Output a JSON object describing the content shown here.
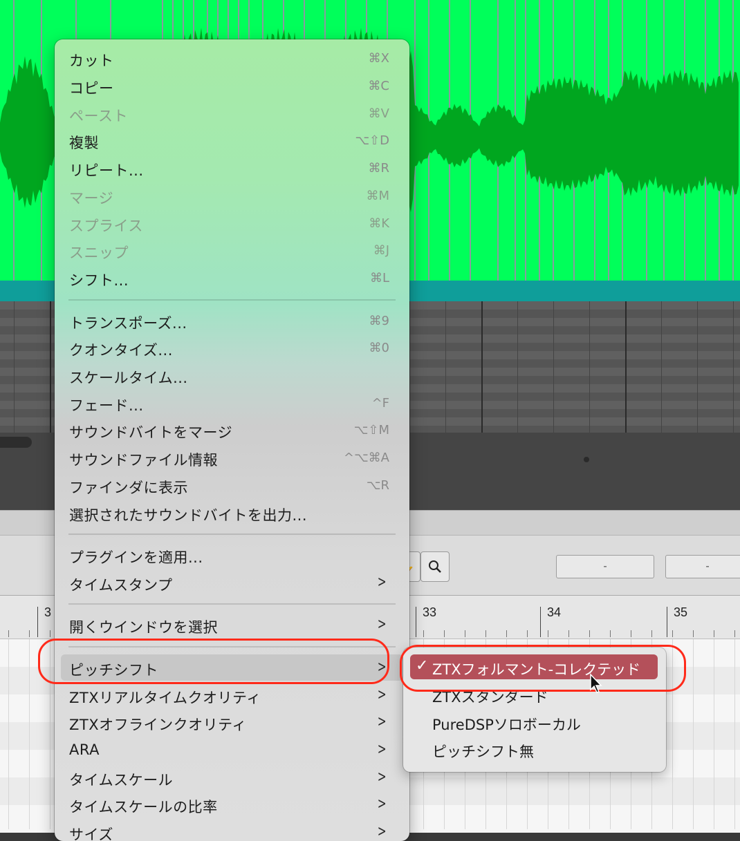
{
  "menu": {
    "items": [
      {
        "label": "カット",
        "shortcut": "⌘X",
        "enabled": true
      },
      {
        "label": "コピー",
        "shortcut": "⌘C",
        "enabled": true
      },
      {
        "label": "ペースト",
        "shortcut": "⌘V",
        "enabled": false
      },
      {
        "label": "複製",
        "shortcut": "⌥⇧D",
        "enabled": true
      },
      {
        "label": "リピート...",
        "shortcut": "⌘R",
        "enabled": true
      },
      {
        "label": "マージ",
        "shortcut": "⌘M",
        "enabled": false
      },
      {
        "label": "スプライス",
        "shortcut": "⌘K",
        "enabled": false
      },
      {
        "label": "スニップ",
        "shortcut": "⌘J",
        "enabled": false
      },
      {
        "label": "シフト...",
        "shortcut": "⌘L",
        "enabled": true
      },
      {
        "label": "トランスポーズ...",
        "shortcut": "⌘9",
        "enabled": true
      },
      {
        "label": "クオンタイズ...",
        "shortcut": "⌘0",
        "enabled": true
      },
      {
        "label": "スケールタイム...",
        "shortcut": "",
        "enabled": true
      },
      {
        "label": "フェード...",
        "shortcut": "^F",
        "enabled": true
      },
      {
        "label": "サウンドバイトをマージ",
        "shortcut": "⌥⇧M",
        "enabled": true
      },
      {
        "label": "サウンドファイル情報",
        "shortcut": "^⌥⌘A",
        "enabled": true
      },
      {
        "label": "ファインダに表示",
        "shortcut": "⌥R",
        "enabled": true
      },
      {
        "label": "選択されたサウンドバイトを出力...",
        "shortcut": "",
        "enabled": true
      },
      {
        "label": "プラグインを適用...",
        "shortcut": "",
        "enabled": true
      },
      {
        "label": "タイムスタンプ",
        "submenu": true,
        "enabled": true
      },
      {
        "label": "開くウインドウを選択",
        "submenu": true,
        "enabled": true
      },
      {
        "label": "ピッチシフト",
        "submenu": true,
        "enabled": true,
        "highlighted": true
      },
      {
        "label": "ZTXリアルタイムクオリティ",
        "submenu": true,
        "enabled": true
      },
      {
        "label": "ZTXオフラインクオリティ",
        "submenu": true,
        "enabled": true
      },
      {
        "label": "ARA",
        "submenu": true,
        "enabled": true
      },
      {
        "label": "タイムスケール",
        "submenu": true,
        "enabled": true
      },
      {
        "label": "タイムスケールの比率",
        "submenu": true,
        "enabled": true
      },
      {
        "label": "サイズ",
        "submenu": true,
        "enabled": true
      }
    ]
  },
  "submenu": {
    "items": [
      {
        "label": "ZTXフォルマント-コレクテッド",
        "checked": true,
        "selected": true
      },
      {
        "label": "ZTXスタンダード",
        "checked": false
      },
      {
        "label": "PureDSPソロボーカル",
        "checked": false
      },
      {
        "label": "ピッチシフト無",
        "checked": false
      }
    ]
  },
  "ruler": {
    "labels": [
      "3",
      "33",
      "34",
      "35"
    ]
  },
  "toolbar": {
    "field1": "-",
    "field2": "-"
  },
  "colors": {
    "waveform_bg": "#00ff5a",
    "waveform": "#00a61f",
    "selection": "#b4505a",
    "annotation": "#ff2a1a"
  }
}
